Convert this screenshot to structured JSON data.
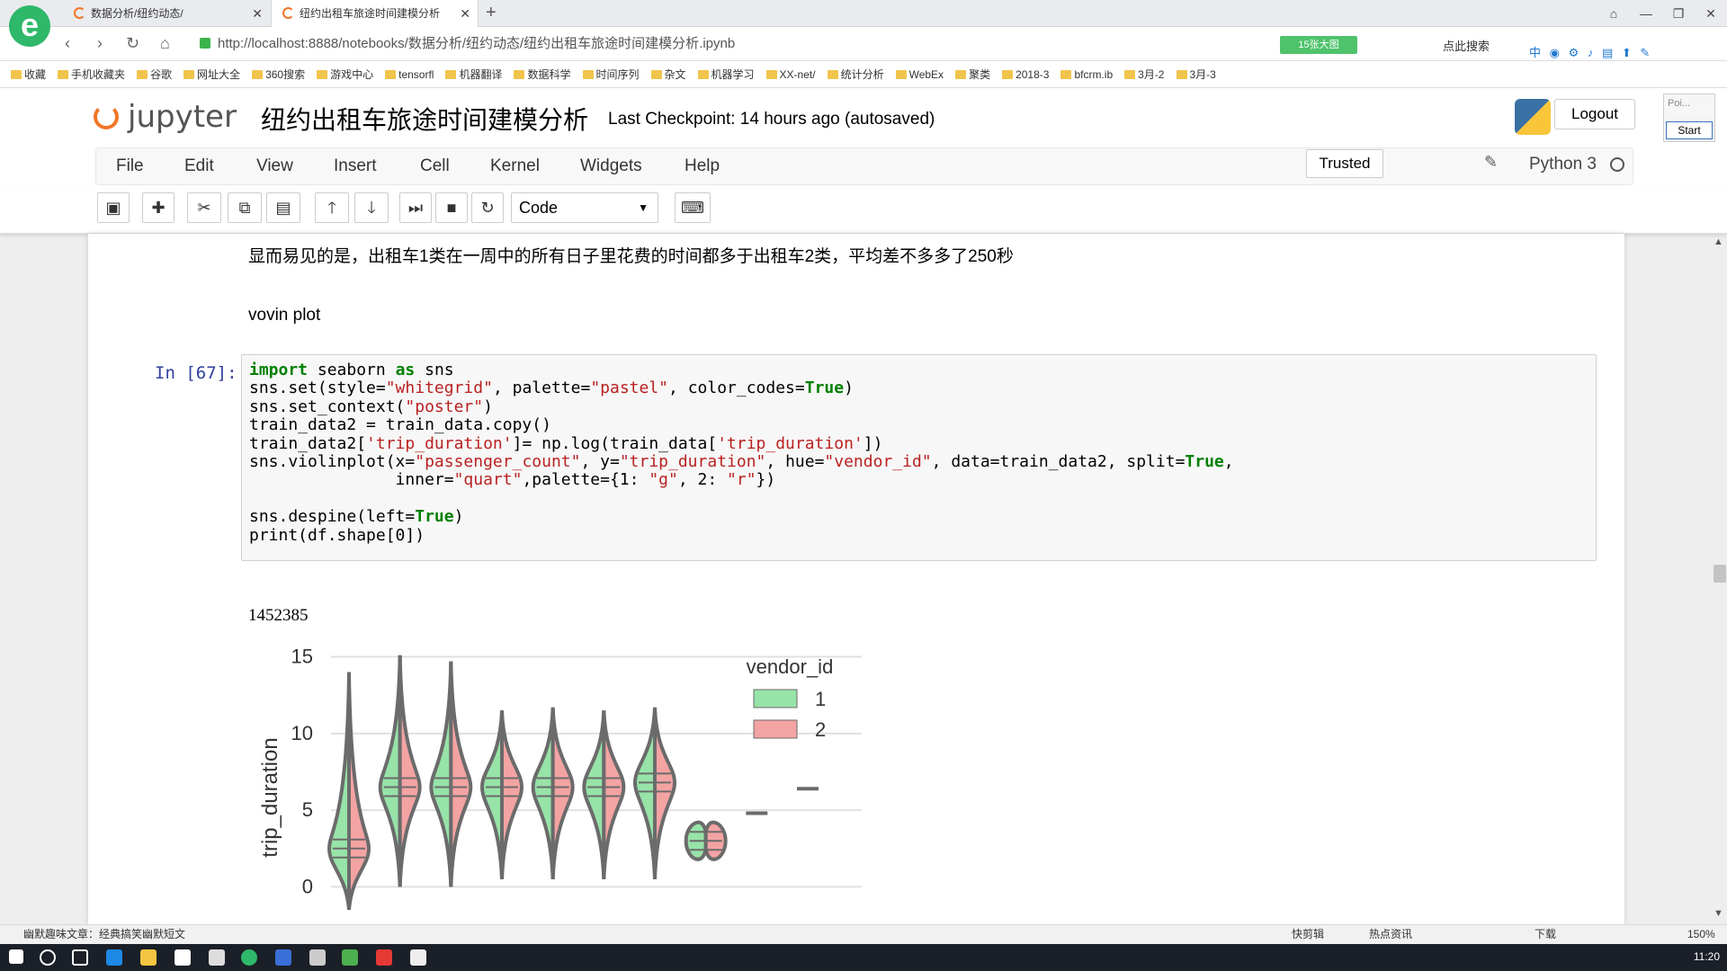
{
  "browser": {
    "tabs": [
      {
        "title": "数据分析/纽约动态/"
      },
      {
        "title": "纽约出租车旅途时间建模分析"
      }
    ],
    "url_base": "http://localhost:8888/notebooks/数据分析/纽约动态/纽约出租车旅途时间建模分析.ipynb",
    "url_tag": "15张大图",
    "search_label": "点此搜索",
    "bookmarks": [
      "收藏",
      "手机收藏夹",
      "谷歌",
      "网址大全",
      "360搜索",
      "游戏中心",
      "tensorfl",
      "机器翻译",
      "数据科学",
      "时间序列",
      "杂文",
      "机器学习",
      "XX-net/",
      "统计分析",
      "WebEx",
      "聚类",
      "2018-3",
      "bfcrm.ib",
      "3月-2",
      "3月-3"
    ]
  },
  "jupyter": {
    "logo_text": "jupyter",
    "notebook_title": "纽约出租车旅途时间建模分析",
    "checkpoint": "Last Checkpoint: 14 hours ago (autosaved)",
    "logout_label": "Logout",
    "side_popup": {
      "label": "Poi...",
      "button": "Start"
    },
    "menu": [
      "File",
      "Edit",
      "View",
      "Insert",
      "Cell",
      "Kernel",
      "Widgets",
      "Help"
    ],
    "trusted_label": "Trusted",
    "kernel_name": "Python 3",
    "cell_type": "Code"
  },
  "notebook": {
    "markdown_text": "显而易见的是，出租车1类在一周中的所有日子里花费的时间都多于出租车2类，平均差不多多了250秒",
    "markdown_heading": "vovin plot",
    "prompt": "In [67]:",
    "code_lines": [
      "import seaborn as sns",
      "sns.set(style=\"whitegrid\", palette=\"pastel\", color_codes=True)",
      "sns.set_context(\"poster\")",
      "train_data2 = train_data.copy()",
      "train_data2['trip_duration']= np.log(train_data['trip_duration'])",
      "sns.violinplot(x=\"passenger_count\", y=\"trip_duration\", hue=\"vendor_id\", data=train_data2, split=True,",
      "               inner=\"quart\",palette={1: \"g\", 2: \"r\"})",
      "",
      "sns.despine(left=True)",
      "print(df.shape[0])"
    ],
    "output": "1452385"
  },
  "chart_data": {
    "type": "violin",
    "xlabel": "",
    "ylabel": "trip_duration",
    "ylim": [
      -1.5,
      15.5
    ],
    "yticks": [
      0,
      5,
      10,
      15
    ],
    "grid": true,
    "legend": {
      "title": "vendor_id",
      "placement": "top-right",
      "entries": [
        "1",
        "2"
      ]
    },
    "colors": {
      "1": "#97e3a8",
      "2": "#f4a3a3",
      "outline": "#6b6b6b",
      "grid": "#e0e0e0"
    },
    "series": [
      {
        "violin": 0,
        "center": 2.5,
        "min": -1.5,
        "max": 14
      },
      {
        "violin": 1,
        "center": 6.5,
        "min": 0,
        "max": 15.1
      },
      {
        "violin": 2,
        "center": 6.5,
        "min": 0,
        "max": 14.7
      },
      {
        "violin": 3,
        "center": 6.5,
        "min": 0.5,
        "max": 11.5
      },
      {
        "violin": 4,
        "center": 6.5,
        "min": 0.5,
        "max": 11.7
      },
      {
        "violin": 5,
        "center": 6.5,
        "min": 0.5,
        "max": 11.5
      },
      {
        "violin": 6,
        "center": 6.8,
        "min": 0.5,
        "max": 11.7
      },
      {
        "violin": 7,
        "center": 3.0,
        "min": 2.5,
        "max": 3.5
      },
      {
        "violin": 8,
        "center": 4.8,
        "min": 4.8,
        "max": 4.8
      },
      {
        "violin": 9,
        "center": 6.4,
        "min": 6.4,
        "max": 6.4
      }
    ]
  },
  "status": {
    "left_text": "幽默趣味文章：经典搞笑幽默短文",
    "right_items": [
      "快剪辑",
      "热点资讯",
      "下载",
      "150%"
    ]
  },
  "taskbar": {
    "clock": "11:20"
  }
}
